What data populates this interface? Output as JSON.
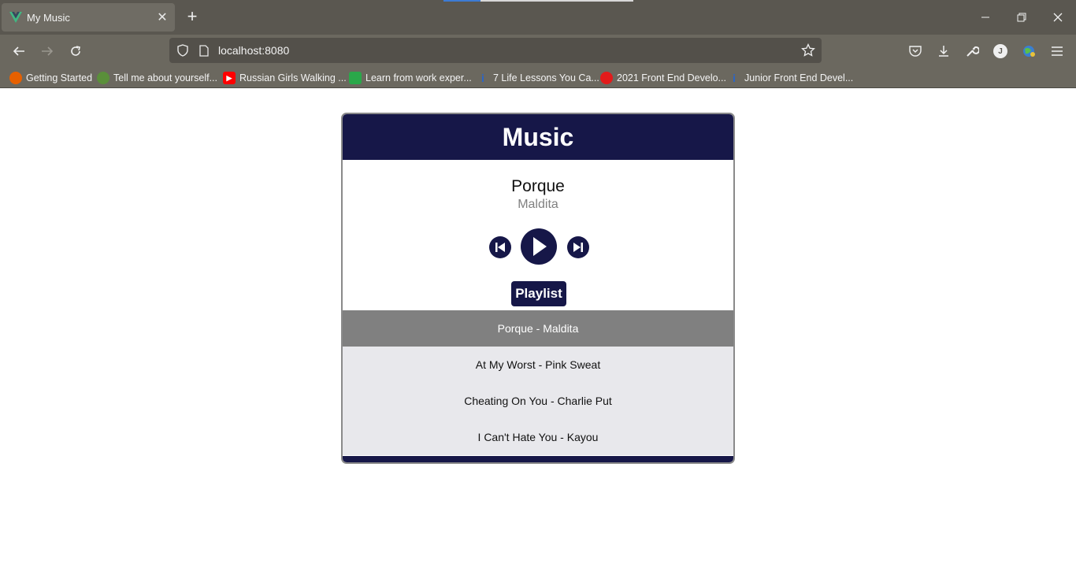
{
  "browser": {
    "tab_title": "My Music",
    "url": "localhost:8080",
    "bookmarks": [
      {
        "label": "Getting Started",
        "icon": "firefox-icon",
        "color": "#e66000"
      },
      {
        "label": "Tell me about yourself...",
        "icon": "leaf-icon",
        "color": "#5a8f3a"
      },
      {
        "label": "Russian Girls Walking ...",
        "icon": "youtube-icon",
        "color": "#ff0000"
      },
      {
        "label": "Learn from work exper...",
        "icon": "edge-icon",
        "color": "#2aa84a"
      },
      {
        "label": "7 Life Lessons You Ca...",
        "icon": "info-icon",
        "color": "#2a65c8"
      },
      {
        "label": "2021 Front End Develo...",
        "icon": "gfg-icon",
        "color": "#e21b1b"
      },
      {
        "label": "Junior Front End Devel...",
        "icon": "info-icon",
        "color": "#2a65c8"
      }
    ],
    "profile_initial": "J"
  },
  "app": {
    "header_title": "Music",
    "current_song": {
      "title": "Porque",
      "artist": "Maldita"
    },
    "playlist_button_label": "Playlist",
    "tracks": [
      {
        "label": "Porque - Maldita",
        "active": true
      },
      {
        "label": "At My Worst - Pink Sweat",
        "active": false
      },
      {
        "label": "Cheating On You - Charlie Put",
        "active": false
      },
      {
        "label": "I Can't Hate You - Kayou",
        "active": false
      }
    ],
    "colors": {
      "primary": "#161748",
      "active_track": "#808080",
      "track_bg": "#e8e8ec"
    }
  }
}
